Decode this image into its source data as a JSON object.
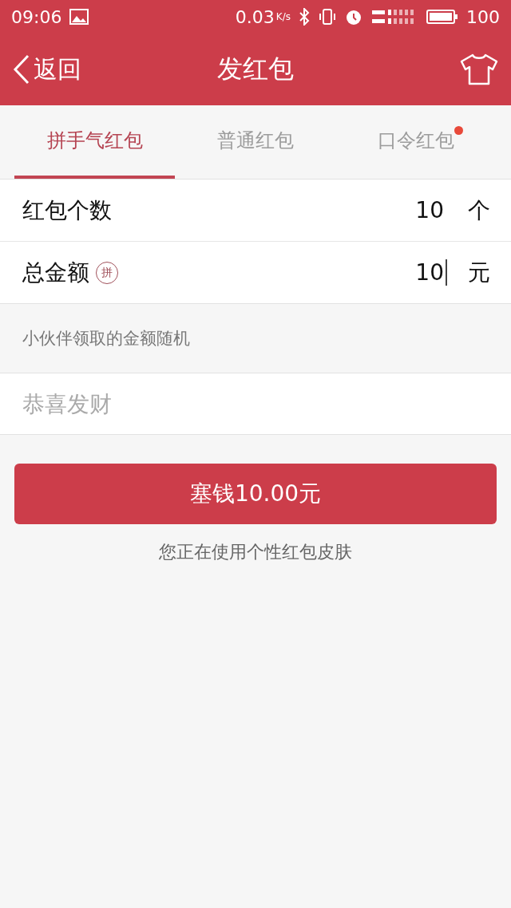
{
  "status_bar": {
    "time": "09:06",
    "speed": "0.03",
    "speed_unit": "K/s",
    "battery": "100"
  },
  "header": {
    "back": "返回",
    "title": "发红包"
  },
  "tabs": [
    {
      "label": "拼手气红包",
      "selected": true,
      "dot": false
    },
    {
      "label": "普通红包",
      "selected": false,
      "dot": false
    },
    {
      "label": "口令红包",
      "selected": false,
      "dot": true
    }
  ],
  "fields": [
    {
      "label": "红包个数",
      "value": "10",
      "unit": "个",
      "focused": false
    },
    {
      "label": "总金额",
      "badge": "拼",
      "value": "10",
      "unit": "元",
      "focused": true
    }
  ],
  "hint": "小伙伴领取的金额随机",
  "greeting": {
    "placeholder": "恭喜发财"
  },
  "submit": "塞钱10.00元",
  "note": "您正在使用个性红包皮肤"
}
